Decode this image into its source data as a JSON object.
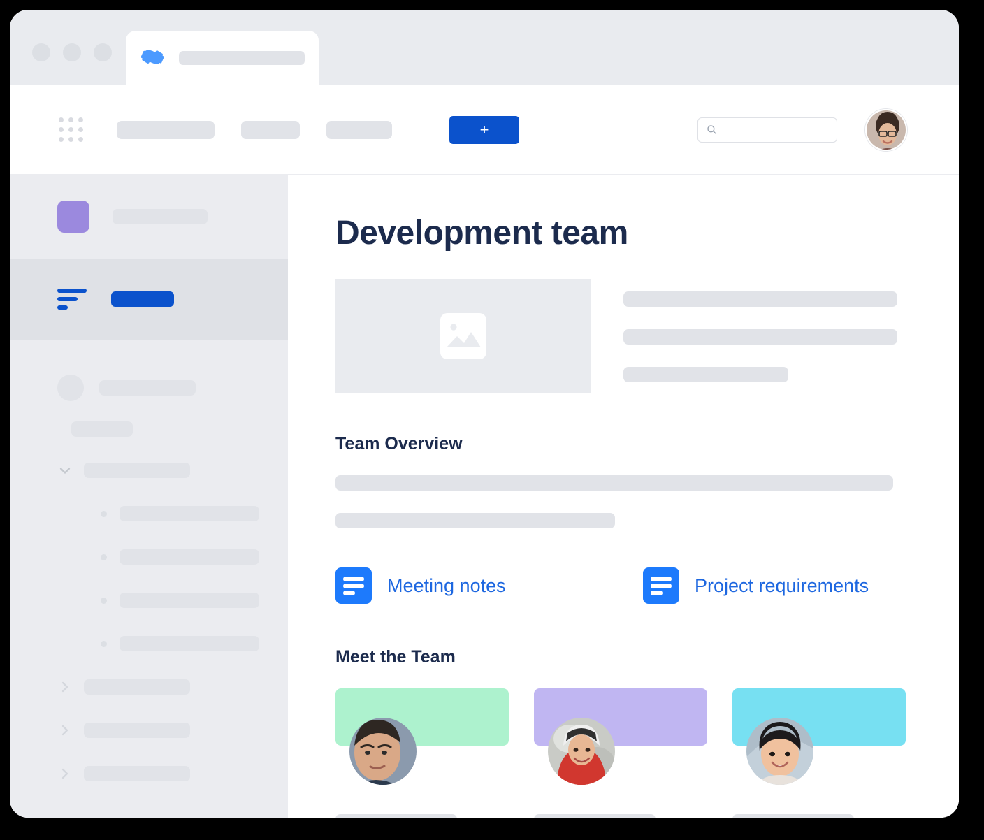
{
  "window": {
    "browser_tab": {
      "logo_icon": "confluence-logo-icon",
      "title_placeholder": ""
    },
    "traffic_lights": [
      "close",
      "minimize",
      "maximize"
    ]
  },
  "topnav": {
    "app_switcher_icon": "grid-apps-icon",
    "nav_placeholders": [
      "",
      "",
      ""
    ],
    "create_button_label": "+",
    "search": {
      "icon": "search-icon",
      "value": "",
      "placeholder": ""
    },
    "profile_avatar_alt": "user-avatar"
  },
  "sidebar": {
    "space": {
      "avatar_color": "#9b89de",
      "name_placeholder": ""
    },
    "active_item": {
      "icon": "content-lines-icon",
      "label_placeholder": "",
      "accent_color": "#0b52cc"
    },
    "items": [
      {
        "type": "space-row",
        "icon": "circle-avatar-icon",
        "label_placeholder": ""
      },
      {
        "type": "section-label",
        "label_placeholder": ""
      },
      {
        "type": "tree-expanded",
        "icon": "chevron-down-icon",
        "label_placeholder": ""
      },
      {
        "type": "tree-child",
        "icon": "bullet-icon",
        "label_placeholder": ""
      },
      {
        "type": "tree-child",
        "icon": "bullet-icon",
        "label_placeholder": ""
      },
      {
        "type": "tree-child",
        "icon": "bullet-icon",
        "label_placeholder": ""
      },
      {
        "type": "tree-child",
        "icon": "bullet-icon",
        "label_placeholder": ""
      },
      {
        "type": "tree-collapsed",
        "icon": "chevron-right-icon",
        "label_placeholder": ""
      },
      {
        "type": "tree-collapsed",
        "icon": "chevron-right-icon",
        "label_placeholder": ""
      },
      {
        "type": "tree-collapsed",
        "icon": "chevron-right-icon",
        "label_placeholder": ""
      }
    ]
  },
  "main": {
    "page_title": "Development team",
    "hero": {
      "image_placeholder_icon": "image-placeholder-icon",
      "text_lines": [
        "",
        "",
        ""
      ]
    },
    "team_overview": {
      "heading": "Team Overview",
      "paragraph_lines": [
        "",
        ""
      ]
    },
    "doc_links": [
      {
        "icon": "document-icon",
        "label": "Meeting notes",
        "color": "#1d67e0"
      },
      {
        "icon": "document-icon",
        "label": "Project requirements",
        "color": "#1d67e0"
      }
    ],
    "meet_the_team": {
      "heading": "Meet the Team",
      "members": [
        {
          "banner_color": "#adf2ce",
          "avatar_alt": "team-member-avatar",
          "name_placeholder": ""
        },
        {
          "banner_color": "#c0b6f2",
          "avatar_alt": "team-member-avatar",
          "name_placeholder": ""
        },
        {
          "banner_color": "#77e0f2",
          "avatar_alt": "team-member-avatar",
          "name_placeholder": ""
        }
      ]
    }
  },
  "colors": {
    "brand_blue": "#0b52cc",
    "link_blue": "#1d67e0",
    "heading_navy": "#1c2b4d",
    "skeleton_gray": "#e1e3e8",
    "sidebar_bg": "#ebecf0",
    "sidebar_active_bg": "#dfe1e6",
    "chrome_bg": "#e9ebef"
  }
}
